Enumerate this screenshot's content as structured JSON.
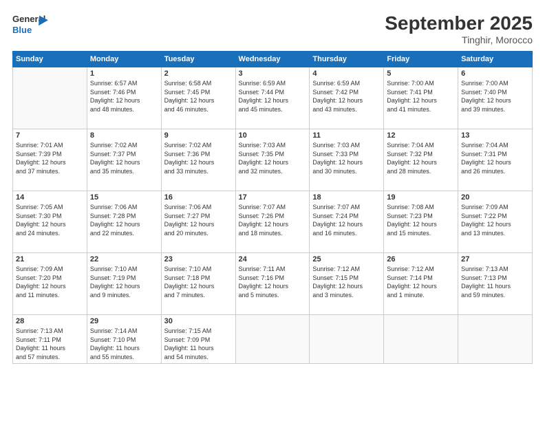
{
  "logo": {
    "line1": "General",
    "line2": "Blue"
  },
  "header": {
    "month": "September 2025",
    "location": "Tinghir, Morocco"
  },
  "days_of_week": [
    "Sunday",
    "Monday",
    "Tuesday",
    "Wednesday",
    "Thursday",
    "Friday",
    "Saturday"
  ],
  "weeks": [
    [
      {
        "num": "",
        "info": ""
      },
      {
        "num": "1",
        "info": "Sunrise: 6:57 AM\nSunset: 7:46 PM\nDaylight: 12 hours\nand 48 minutes."
      },
      {
        "num": "2",
        "info": "Sunrise: 6:58 AM\nSunset: 7:45 PM\nDaylight: 12 hours\nand 46 minutes."
      },
      {
        "num": "3",
        "info": "Sunrise: 6:59 AM\nSunset: 7:44 PM\nDaylight: 12 hours\nand 45 minutes."
      },
      {
        "num": "4",
        "info": "Sunrise: 6:59 AM\nSunset: 7:42 PM\nDaylight: 12 hours\nand 43 minutes."
      },
      {
        "num": "5",
        "info": "Sunrise: 7:00 AM\nSunset: 7:41 PM\nDaylight: 12 hours\nand 41 minutes."
      },
      {
        "num": "6",
        "info": "Sunrise: 7:00 AM\nSunset: 7:40 PM\nDaylight: 12 hours\nand 39 minutes."
      }
    ],
    [
      {
        "num": "7",
        "info": "Sunrise: 7:01 AM\nSunset: 7:39 PM\nDaylight: 12 hours\nand 37 minutes."
      },
      {
        "num": "8",
        "info": "Sunrise: 7:02 AM\nSunset: 7:37 PM\nDaylight: 12 hours\nand 35 minutes."
      },
      {
        "num": "9",
        "info": "Sunrise: 7:02 AM\nSunset: 7:36 PM\nDaylight: 12 hours\nand 33 minutes."
      },
      {
        "num": "10",
        "info": "Sunrise: 7:03 AM\nSunset: 7:35 PM\nDaylight: 12 hours\nand 32 minutes."
      },
      {
        "num": "11",
        "info": "Sunrise: 7:03 AM\nSunset: 7:33 PM\nDaylight: 12 hours\nand 30 minutes."
      },
      {
        "num": "12",
        "info": "Sunrise: 7:04 AM\nSunset: 7:32 PM\nDaylight: 12 hours\nand 28 minutes."
      },
      {
        "num": "13",
        "info": "Sunrise: 7:04 AM\nSunset: 7:31 PM\nDaylight: 12 hours\nand 26 minutes."
      }
    ],
    [
      {
        "num": "14",
        "info": "Sunrise: 7:05 AM\nSunset: 7:30 PM\nDaylight: 12 hours\nand 24 minutes."
      },
      {
        "num": "15",
        "info": "Sunrise: 7:06 AM\nSunset: 7:28 PM\nDaylight: 12 hours\nand 22 minutes."
      },
      {
        "num": "16",
        "info": "Sunrise: 7:06 AM\nSunset: 7:27 PM\nDaylight: 12 hours\nand 20 minutes."
      },
      {
        "num": "17",
        "info": "Sunrise: 7:07 AM\nSunset: 7:26 PM\nDaylight: 12 hours\nand 18 minutes."
      },
      {
        "num": "18",
        "info": "Sunrise: 7:07 AM\nSunset: 7:24 PM\nDaylight: 12 hours\nand 16 minutes."
      },
      {
        "num": "19",
        "info": "Sunrise: 7:08 AM\nSunset: 7:23 PM\nDaylight: 12 hours\nand 15 minutes."
      },
      {
        "num": "20",
        "info": "Sunrise: 7:09 AM\nSunset: 7:22 PM\nDaylight: 12 hours\nand 13 minutes."
      }
    ],
    [
      {
        "num": "21",
        "info": "Sunrise: 7:09 AM\nSunset: 7:20 PM\nDaylight: 12 hours\nand 11 minutes."
      },
      {
        "num": "22",
        "info": "Sunrise: 7:10 AM\nSunset: 7:19 PM\nDaylight: 12 hours\nand 9 minutes."
      },
      {
        "num": "23",
        "info": "Sunrise: 7:10 AM\nSunset: 7:18 PM\nDaylight: 12 hours\nand 7 minutes."
      },
      {
        "num": "24",
        "info": "Sunrise: 7:11 AM\nSunset: 7:16 PM\nDaylight: 12 hours\nand 5 minutes."
      },
      {
        "num": "25",
        "info": "Sunrise: 7:12 AM\nSunset: 7:15 PM\nDaylight: 12 hours\nand 3 minutes."
      },
      {
        "num": "26",
        "info": "Sunrise: 7:12 AM\nSunset: 7:14 PM\nDaylight: 12 hours\nand 1 minute."
      },
      {
        "num": "27",
        "info": "Sunrise: 7:13 AM\nSunset: 7:13 PM\nDaylight: 11 hours\nand 59 minutes."
      }
    ],
    [
      {
        "num": "28",
        "info": "Sunrise: 7:13 AM\nSunset: 7:11 PM\nDaylight: 11 hours\nand 57 minutes."
      },
      {
        "num": "29",
        "info": "Sunrise: 7:14 AM\nSunset: 7:10 PM\nDaylight: 11 hours\nand 55 minutes."
      },
      {
        "num": "30",
        "info": "Sunrise: 7:15 AM\nSunset: 7:09 PM\nDaylight: 11 hours\nand 54 minutes."
      },
      {
        "num": "",
        "info": ""
      },
      {
        "num": "",
        "info": ""
      },
      {
        "num": "",
        "info": ""
      },
      {
        "num": "",
        "info": ""
      }
    ]
  ]
}
